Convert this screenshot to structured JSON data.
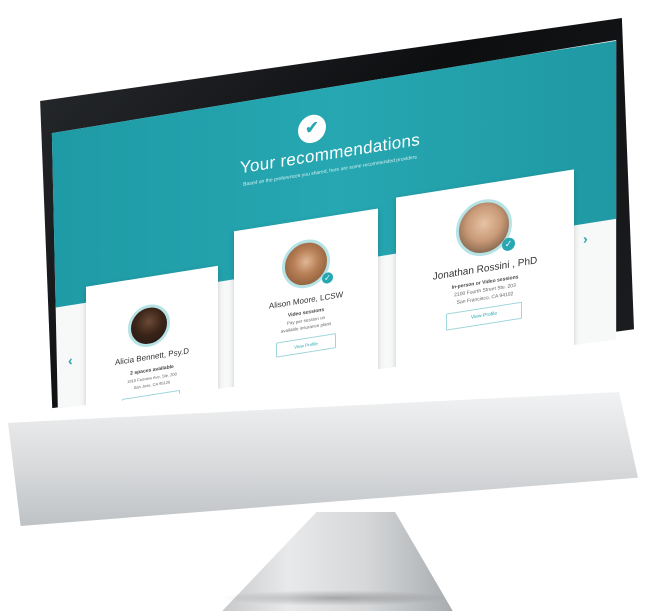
{
  "hero": {
    "title": "Your recommendations",
    "subtitle": "Based on the preferences you shared, here are some recommended providers"
  },
  "cards": [
    {
      "name": "Alicia Bennett, Psy.D",
      "line1": "2 spaces available",
      "line2": "1910 Fairview Ave, Ste. 200",
      "line3": "San Jose, CA 95126",
      "button": "View Profile"
    },
    {
      "name": "Alison Moore, LCSW",
      "line1": "Video sessions",
      "line2": "Pay per session on",
      "line3": "available insurance plans",
      "button": "View Profile"
    },
    {
      "name": "Jonathan Rossini , PhD",
      "line1": "In-person or Video sessions",
      "line2": "2100 Fourth Street Ste. 203",
      "line3": "San Francisco, CA 94102",
      "button": "View Profile"
    }
  ],
  "carousel": {
    "page_count": 2,
    "active_page": 1
  },
  "icons": {
    "hero": "check-circle-icon",
    "badge": "verified-badge-icon",
    "prev": "chevron-left-icon",
    "next": "chevron-right-icon",
    "brand": "apple-logo-icon"
  },
  "colors": {
    "accent": "#26a7b1",
    "banner": "#1f9ea9",
    "background": "#f7f8f8"
  }
}
